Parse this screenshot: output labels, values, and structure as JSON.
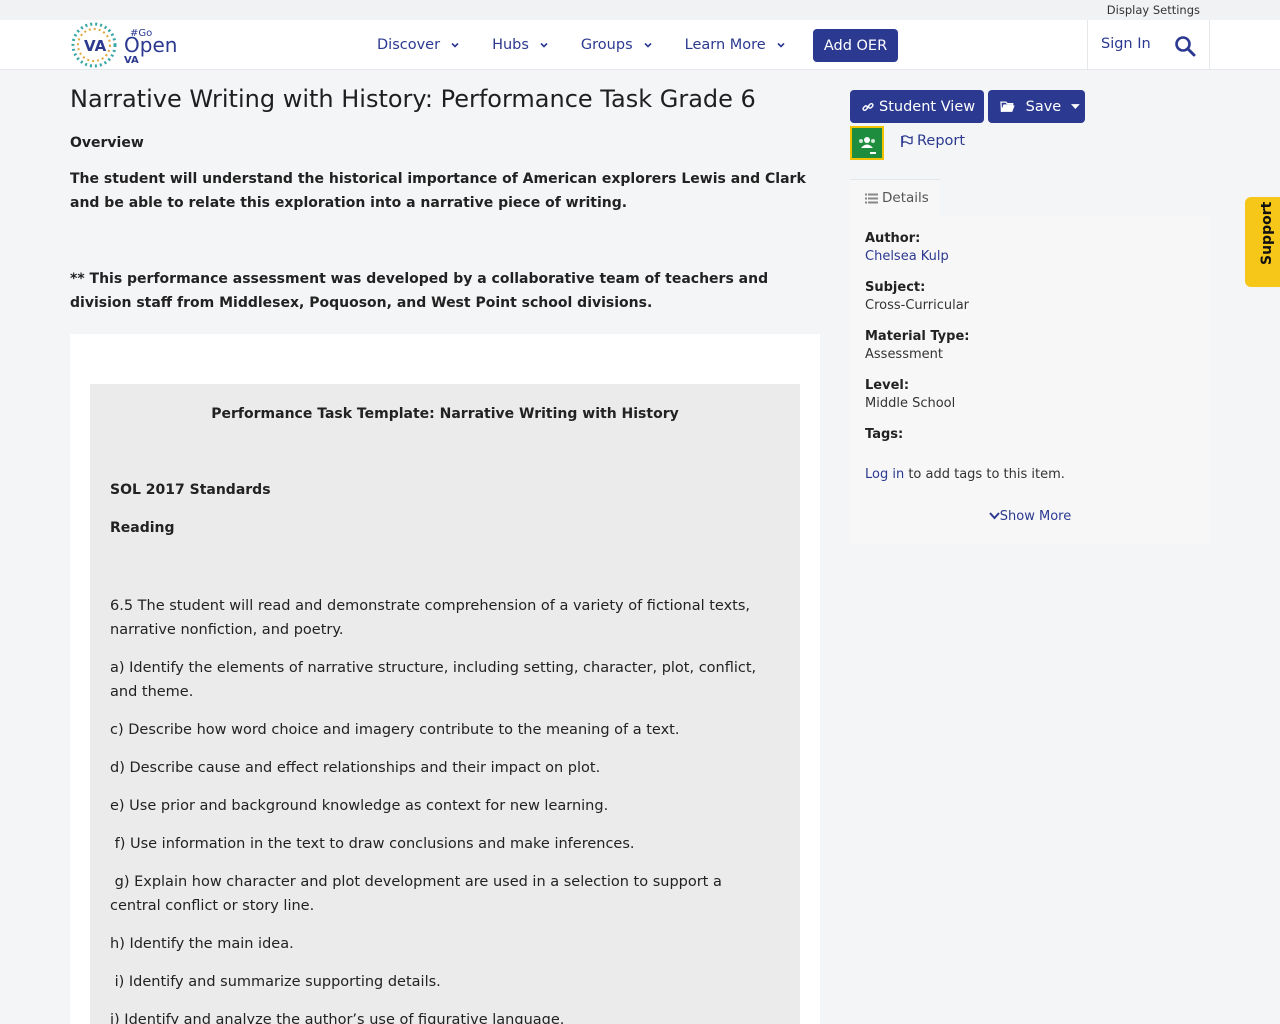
{
  "topbar": {
    "display_settings": "Display Settings"
  },
  "nav": {
    "logo_va": "VA",
    "logo_go": "#Go",
    "logo_open": "Open",
    "logo_va2": "VA",
    "items": [
      {
        "label": "Discover"
      },
      {
        "label": "Hubs"
      },
      {
        "label": "Groups"
      },
      {
        "label": "Learn More"
      }
    ],
    "add_oer": "Add OER",
    "sign_in": "Sign In"
  },
  "page": {
    "title": "Narrative Writing with History: Performance Task Grade 6",
    "overview_heading": "Overview",
    "overview_text": "The student will understand the historical importance of American explorers Lewis and Clark and be able to relate this exploration into a narrative piece of writing.",
    "note": "** This performance assessment was developed by a collaborative team of teachers and division staff from Middlesex, Poquoson, and West Point school divisions."
  },
  "template": {
    "title": "Performance Task Template: Narrative Writing with History",
    "sol": "SOL 2017 Standards",
    "reading": "Reading",
    "lines": [
      "6.5 The student will read and demonstrate comprehension of a variety of fictional texts, narrative nonfiction, and poetry.",
      "a) Identify the elements of narrative structure, including setting, character, plot, conflict, and theme.",
      "c) Describe how word choice and imagery contribute to the meaning of a text.",
      "d) Describe cause and effect relationships and their impact on plot.",
      "e) Use prior and background knowledge as context for new learning.",
      " f) Use information in the text to draw conclusions and make inferences.",
      " g) Explain how character and plot development are used in a selection to support a central conflict or story line.",
      "h) Identify the main idea.",
      " i) Identify and summarize supporting details.",
      "j) Identify and analyze the author’s use of figurative language."
    ]
  },
  "actions": {
    "student_view": "Student View",
    "save": "Save",
    "report": "Report"
  },
  "details": {
    "tab": "Details",
    "author_label": "Author:",
    "author": "Chelsea Kulp",
    "subject_label": "Subject:",
    "subject": "Cross-Curricular",
    "material_label": "Material Type:",
    "material": "Assessment",
    "level_label": "Level:",
    "level": "Middle School",
    "tags_label": "Tags:",
    "login_link": "Log in",
    "login_rest": " to add tags to this item.",
    "show_more": "Show More"
  },
  "support": {
    "label": "Support"
  },
  "colors": {
    "brand": "#2b3990",
    "support": "#f6c719",
    "classroom": "#1e8e3e"
  }
}
